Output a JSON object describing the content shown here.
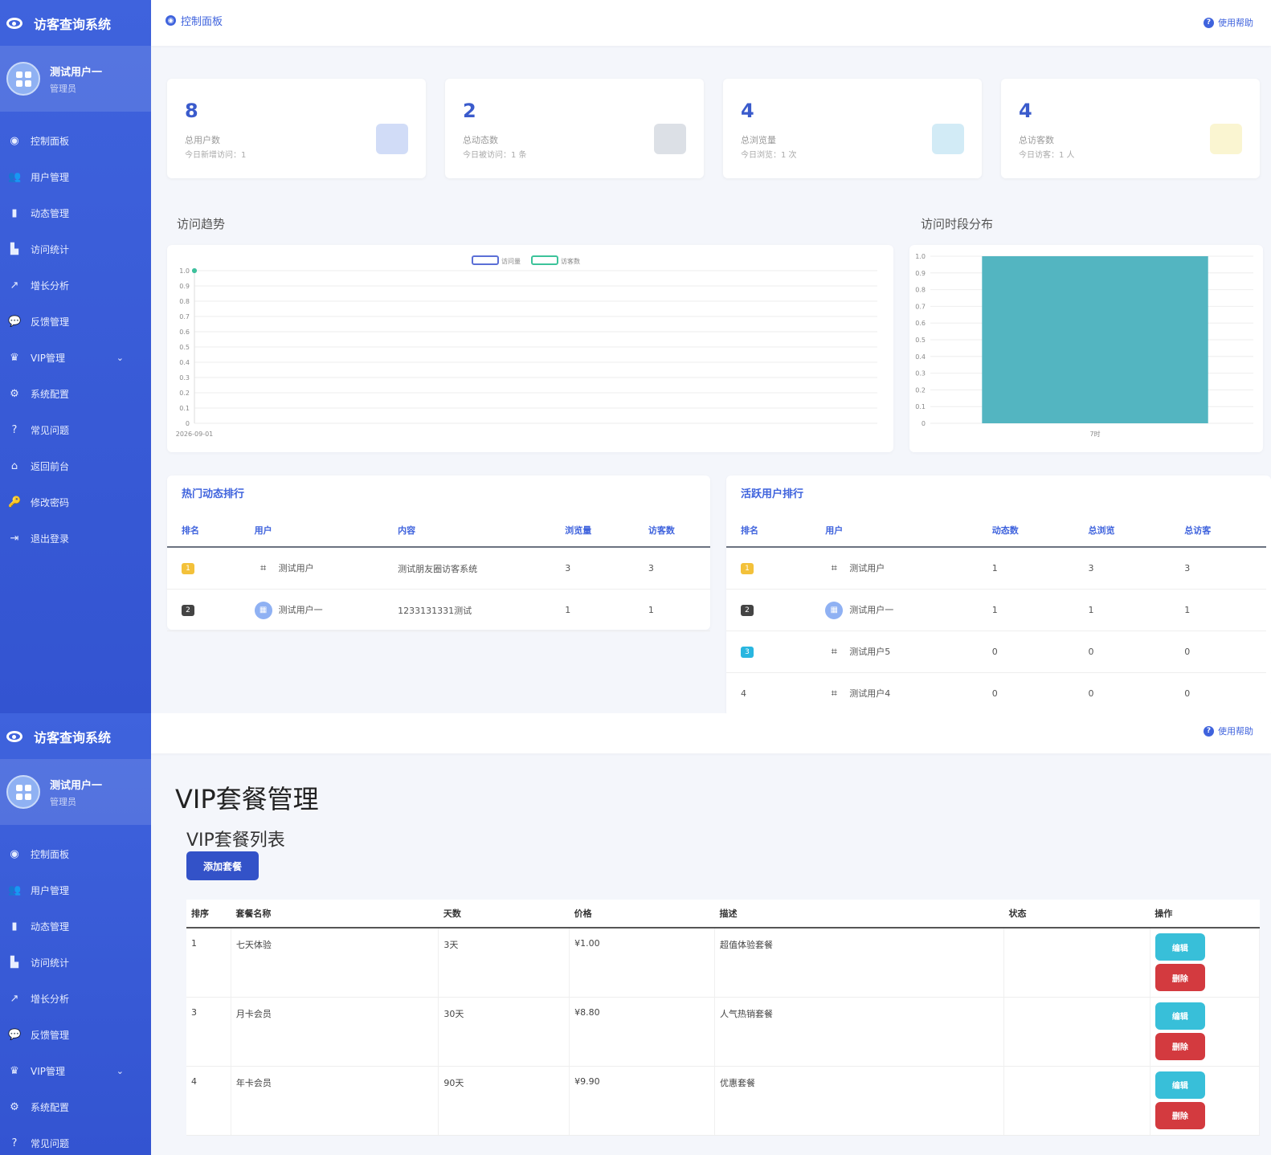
{
  "app": {
    "title": "访客查询系统",
    "help": "使用帮助"
  },
  "user": {
    "name": "测试用户一",
    "role": "管理员"
  },
  "menu": [
    {
      "icon": "dashboard-icon",
      "glyph": "◉",
      "label": "控制面板"
    },
    {
      "icon": "users-icon",
      "glyph": "👥",
      "label": "用户管理"
    },
    {
      "icon": "file-icon",
      "glyph": "▮",
      "label": "动态管理"
    },
    {
      "icon": "stats-icon",
      "glyph": "▙",
      "label": "访问统计"
    },
    {
      "icon": "chart-line-icon",
      "glyph": "↗",
      "label": "增长分析"
    },
    {
      "icon": "comments-icon",
      "glyph": "💬",
      "label": "反馈管理"
    },
    {
      "icon": "crown-icon",
      "glyph": "♛",
      "label": "VIP管理"
    },
    {
      "icon": "gear-icon",
      "glyph": "⚙",
      "label": "系统配置"
    },
    {
      "icon": "question-icon",
      "glyph": "?",
      "label": "常见问题"
    },
    {
      "icon": "home-icon",
      "glyph": "⌂",
      "label": "返回前台"
    },
    {
      "icon": "key-icon",
      "glyph": "🔑",
      "label": "修改密码"
    },
    {
      "icon": "logout-icon",
      "glyph": "⇥",
      "label": "退出登录"
    }
  ],
  "dashboard": {
    "breadcrumb": "控制面板",
    "stats": [
      {
        "value": "8",
        "label": "总用户数",
        "sub": "今日新增访问：1",
        "color": "#7b9be8"
      },
      {
        "value": "2",
        "label": "总动态数",
        "sub": "今日被访问：1 条",
        "color": "#9aa5b8"
      },
      {
        "value": "4",
        "label": "总浏览量",
        "sub": "今日浏览：1 次",
        "color": "#7fc6e6"
      },
      {
        "value": "4",
        "label": "总访客数",
        "sub": "今日访客：1 人",
        "color": "#f1e27a"
      }
    ],
    "trend_title": "访问趋势",
    "hour_title": "访问时段分布",
    "hot_title": "热门动态排行",
    "hot_cols": [
      "排名",
      "用户",
      "内容",
      "浏览量",
      "访客数"
    ],
    "hot_rows": [
      {
        "rank": "1",
        "user": "测试用户",
        "avatar": "qr",
        "content": "测试朋友圈访客系统",
        "views": "3",
        "visitors": "3"
      },
      {
        "rank": "2",
        "user": "测试用户一",
        "avatar": "blue",
        "content": "1233131331测试",
        "views": "1",
        "visitors": "1"
      }
    ],
    "active_title": "活跃用户排行",
    "active_cols": [
      "排名",
      "用户",
      "动态数",
      "总浏览",
      "总访客"
    ],
    "active_rows": [
      {
        "rank": "1",
        "user": "测试用户",
        "avatar": "qr",
        "posts": "1",
        "views": "3",
        "visitors": "3"
      },
      {
        "rank": "2",
        "user": "测试用户一",
        "avatar": "blue",
        "posts": "1",
        "views": "1",
        "visitors": "1"
      },
      {
        "rank": "3",
        "user": "测试用户5",
        "avatar": "qr",
        "posts": "0",
        "views": "0",
        "visitors": "0"
      },
      {
        "rank": "4",
        "user": "测试用户4",
        "avatar": "qr",
        "posts": "0",
        "views": "0",
        "visitors": "0"
      }
    ]
  },
  "chart_data": [
    {
      "type": "line",
      "title": "访问趋势",
      "x": [
        "2026-09-01"
      ],
      "series": [
        {
          "name": "访问量",
          "values": [
            1.0
          ],
          "color": "#5b6fd6"
        },
        {
          "name": "访客数",
          "values": [
            1.0
          ],
          "color": "#3cc39a"
        }
      ],
      "ylim": [
        0,
        1.0
      ],
      "yticks": [
        "0",
        "0.1",
        "0.2",
        "0.3",
        "0.4",
        "0.5",
        "0.6",
        "0.7",
        "0.8",
        "0.9",
        "1.0"
      ],
      "legend": "top-center",
      "grid": true
    },
    {
      "type": "bar",
      "title": "访问时段分布",
      "categories": [
        "7时"
      ],
      "values": [
        1.0
      ],
      "color": "#53b5c1",
      "ylim": [
        0,
        1.0
      ],
      "yticks": [
        "0",
        "0.1",
        "0.2",
        "0.3",
        "0.4",
        "0.5",
        "0.6",
        "0.7",
        "0.8",
        "0.9",
        "1.0"
      ],
      "grid": true
    }
  ],
  "vip": {
    "page_title": "VIP套餐管理",
    "list_title": "VIP套餐列表",
    "add_button": "添加套餐",
    "cols": [
      "排序",
      "套餐名称",
      "天数",
      "价格",
      "描述",
      "状态",
      "操作"
    ],
    "rows": [
      {
        "sort": "1",
        "name": "七天体验",
        "days": "3天",
        "price": "¥1.00",
        "desc": "超值体验套餐",
        "status": ""
      },
      {
        "sort": "3",
        "name": "月卡会员",
        "days": "30天",
        "price": "¥8.80",
        "desc": "人气热销套餐",
        "status": ""
      },
      {
        "sort": "4",
        "name": "年卡会员",
        "days": "90天",
        "price": "¥9.90",
        "desc": "优惠套餐",
        "status": ""
      }
    ],
    "edit_label": "编辑",
    "delete_label": "删除"
  }
}
